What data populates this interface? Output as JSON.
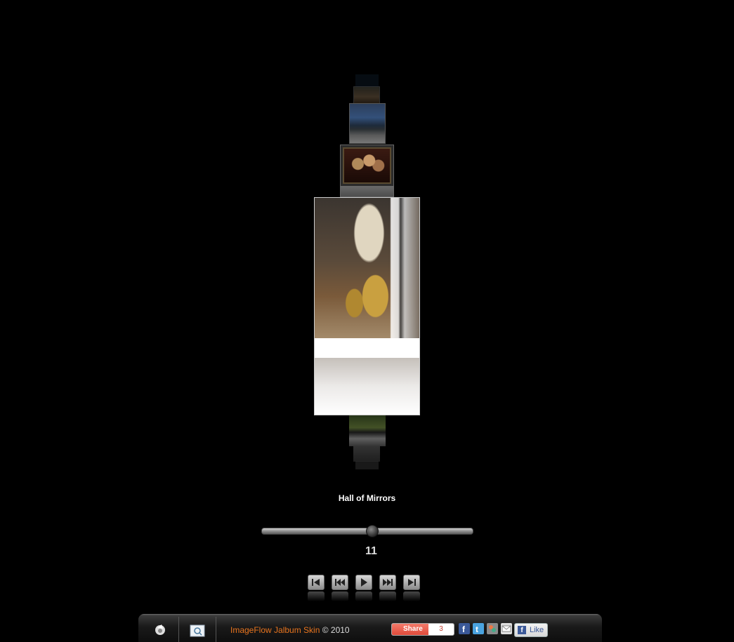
{
  "gallery": {
    "caption": "Hall of Mirrors",
    "current_index": "11",
    "slider_position": 0.52
  },
  "controls": [
    {
      "name": "first-button",
      "icon": "first-icon"
    },
    {
      "name": "previous-button",
      "icon": "rewind-icon"
    },
    {
      "name": "play-button",
      "icon": "play-icon"
    },
    {
      "name": "next-button",
      "icon": "fast-forward-icon"
    },
    {
      "name": "last-button",
      "icon": "last-icon"
    }
  ],
  "footer": {
    "skin_link": "ImageFlow Jalbum Skin",
    "copyright": " © 2010",
    "share_label": "Share",
    "share_count": "3",
    "like_label": "Like",
    "accent_color": "#e8741e"
  }
}
